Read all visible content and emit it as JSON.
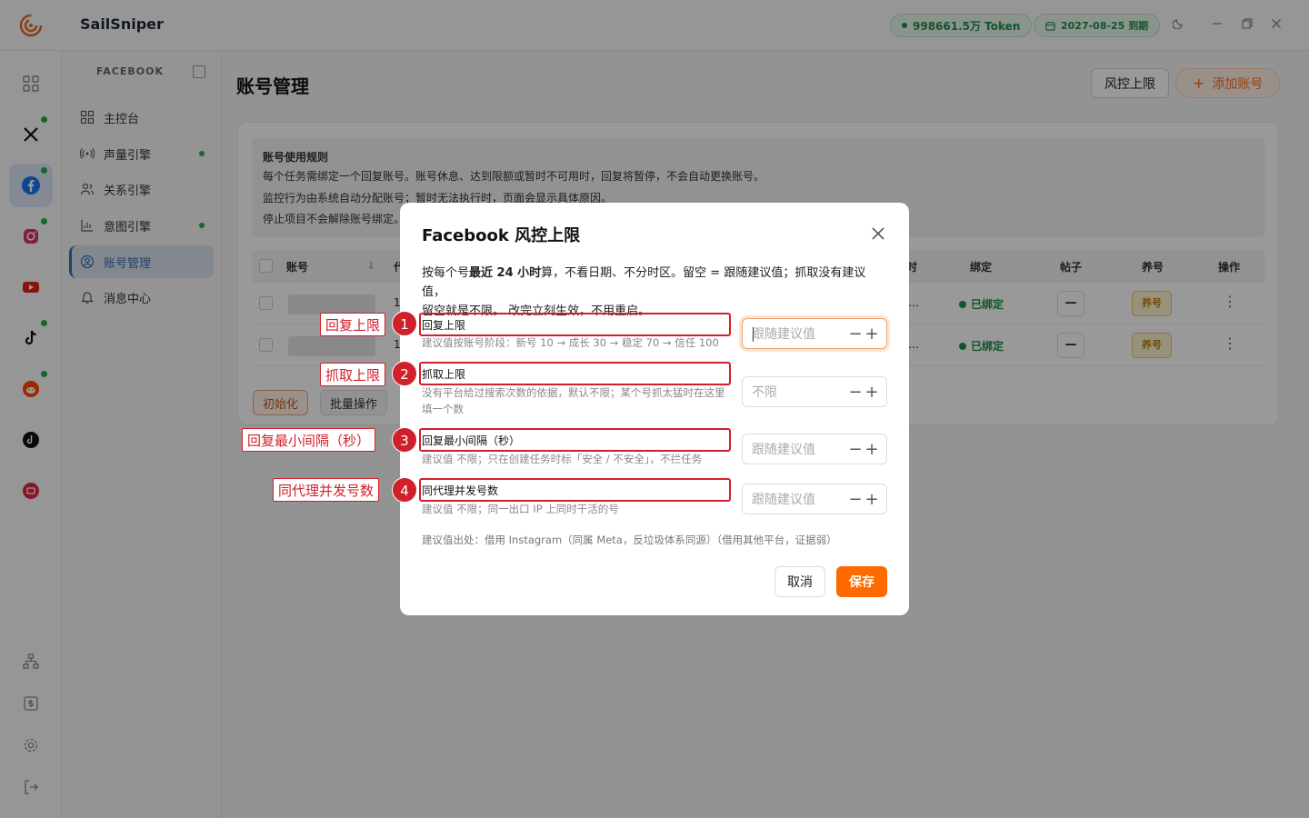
{
  "app": {
    "title": "SailSniper",
    "token_label": "998661.5万 Token",
    "expire_label": "2027-08-25 到期"
  },
  "rail": {
    "items": [
      {
        "name": "dashboard-grid-icon"
      },
      {
        "name": "x-icon"
      },
      {
        "name": "facebook-icon"
      },
      {
        "name": "instagram-icon"
      },
      {
        "name": "youtube-icon"
      },
      {
        "name": "tiktok-icon"
      },
      {
        "name": "reddit-icon"
      },
      {
        "name": "threads-icon"
      },
      {
        "name": "xiaohongshu-icon"
      }
    ]
  },
  "sidebar": {
    "header": "FACEBOOK",
    "items": [
      {
        "label": "主控台"
      },
      {
        "label": "声量引擎"
      },
      {
        "label": "关系引擎"
      },
      {
        "label": "意图引擎"
      },
      {
        "label": "账号管理"
      },
      {
        "label": "消息中心"
      }
    ]
  },
  "main": {
    "title": "账号管理",
    "risk_button": "风控上限",
    "add_button": "添加账号",
    "rules": {
      "title": "账号使用规则",
      "lines": [
        "每个任务需绑定一个回复账号。账号休息、达到限额或暂时不可用时，回复将暂停，不会自动更换账号。",
        "监控行为由系统自动分配账号；暂时无法执行时，页面会显示具体原因。",
        "停止项目不会解除账号绑定。"
      ]
    },
    "table": {
      "headers": {
        "account": "账号",
        "proxy": "代",
        "time": "时",
        "bind": "绑定",
        "posts": "帖子",
        "nurture": "养号",
        "actions": "操作"
      },
      "rows": [
        {
          "proxy": "1",
          "time": "…",
          "bind": "已绑定",
          "posts": "—",
          "nurture": "养号"
        },
        {
          "proxy": "1",
          "time": "…",
          "bind": "已绑定",
          "posts": "—",
          "nurture": "养号"
        }
      ]
    },
    "init_button": "初始化",
    "batch_button": "批量操作"
  },
  "modal": {
    "title": "Facebook 风控上限",
    "desc_pre": "按每个号",
    "desc_bold": "最近 24 小时",
    "desc_post1": "算，不看日期、不分时区。留空 = 跟随建议值；抓取没有建议值，",
    "desc_post2": "留空就是不限。 改完立刻生效，不用重启。",
    "fields": [
      {
        "label": "回复上限",
        "hint": "建议值按账号阶段：新号 10 → 成长 30 → 稳定 70 → 信任 100",
        "placeholder": "跟随建议值"
      },
      {
        "label": "抓取上限",
        "hint": "没有平台给过搜索次数的依据，默认不限；某个号抓太猛时在这里填一个数",
        "placeholder": "不限"
      },
      {
        "label": "回复最小间隔（秒）",
        "hint": "建议值 不限；只在创建任务时标「安全 / 不安全」，不拦任务",
        "placeholder": "跟随建议值"
      },
      {
        "label": "同代理并发号数",
        "hint": "建议值 不限；同一出口 IP 上同时干活的号",
        "placeholder": "跟随建议值"
      }
    ],
    "source_note": "建议值出处：借用 Instagram（同属 Meta，反垃圾体系同源）（借用其他平台，证据弱）",
    "cancel": "取消",
    "save": "保存"
  },
  "annotations": [
    {
      "num": "1",
      "tag": "回复上限"
    },
    {
      "num": "2",
      "tag": "抓取上限"
    },
    {
      "num": "3",
      "tag": "回复最小间隔（秒）"
    },
    {
      "num": "4",
      "tag": "同代理并发号数"
    }
  ],
  "colors": {
    "accent": "#ff6a00",
    "annotation": "#d0202a",
    "success": "#1e8e4a"
  }
}
